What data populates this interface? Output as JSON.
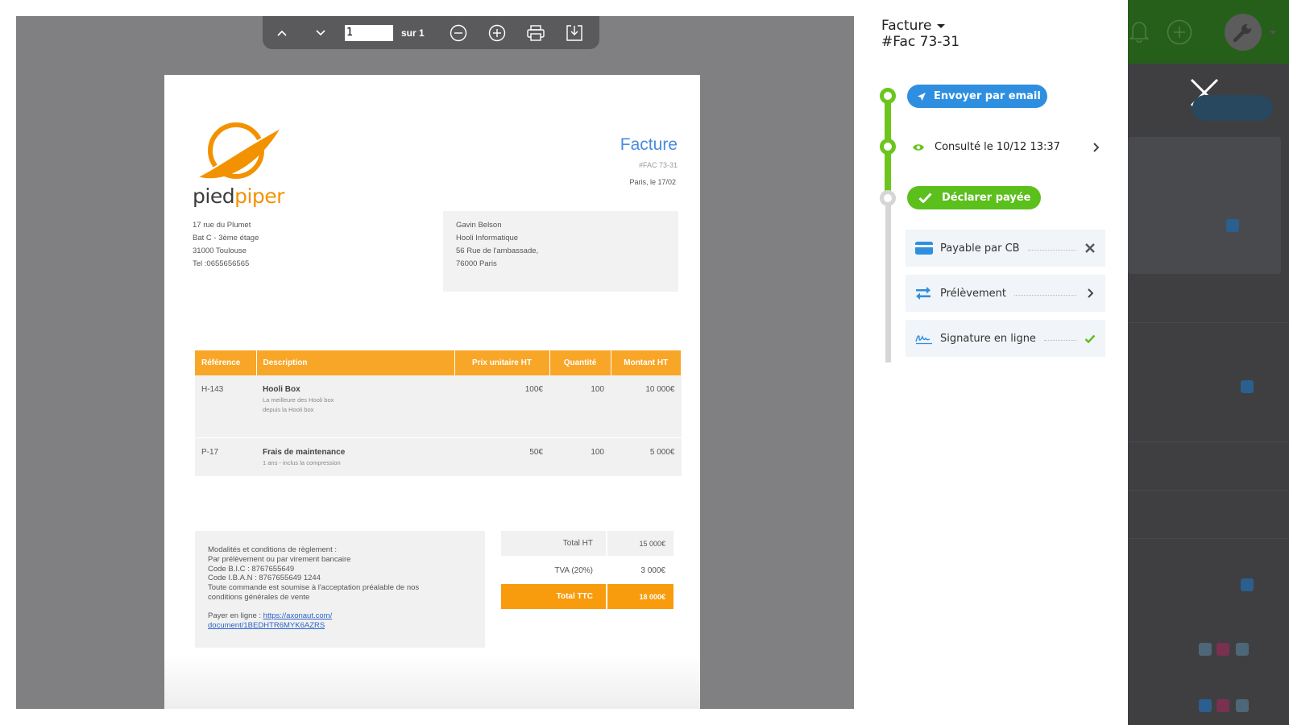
{
  "viewer": {
    "toolbar": {
      "page_value": "1",
      "page_of": "sur 1",
      "buttons": [
        "chevron-up-icon",
        "chevron-down-icon",
        "zoom-out-icon",
        "zoom-in-icon",
        "print-icon",
        "download-icon"
      ]
    }
  },
  "invoice": {
    "brand_part1": "pied",
    "brand_part2": "piper",
    "title": "Facture",
    "number": "#FAC 73-31",
    "date": "Paris, le 17/02",
    "sender": [
      "17 rue du Plumet",
      "Bat C - 3ème étage",
      "31000 Toulouse",
      "Tel :0655656565"
    ],
    "recipient": [
      "Gavin Belson",
      "Hooli Informatique",
      "56 Rue de l'ambassade,",
      "76000 Paris"
    ],
    "table": {
      "headers": [
        "Référence",
        "Description",
        "Prix unitaire HT",
        "Quantité",
        "Montant HT"
      ],
      "rows": [
        {
          "ref": "H-143",
          "name": "Hooli Box",
          "desc1": "La meilleure des Hooli box",
          "desc2": "depuis la Hooli box",
          "price": "100€",
          "qty": "100",
          "amount": "10 000€"
        },
        {
          "ref": "P-17",
          "name": "Frais de maintenance",
          "desc1": "1 ans - inclus la compression",
          "desc2": "",
          "price": "50€",
          "qty": "100",
          "amount": "5 000€"
        }
      ]
    },
    "conditions": {
      "lines": [
        "Modalités et conditions de règlement :",
        "Par prélèvement ou par virement bancaire",
        "Code B.I.C : 8767655649",
        "Code I.B.A.N : 8767655649 1244",
        "Toute commande est soumise à l'acceptation préalable de nos",
        "conditions générales de vente"
      ],
      "pay_label": "Payer en ligne : ",
      "link1": "https://axonaut.com/",
      "link2": "document/1BEDHTR6MYK6AZRS"
    },
    "totals": {
      "ht_label": "Total HT",
      "ht_value": "15 000€",
      "tva_label": "TVA (20%)",
      "tva_value": "3 000€",
      "ttc_label": "Total TTC",
      "ttc_value": "18 000€"
    }
  },
  "panel": {
    "title_line1": "Facture",
    "title_line2": "#Fac 73-31",
    "send_email": "Envoyer par email",
    "viewed": "Consulté le 10/12 13:37",
    "declare_paid": "Déclarer payée",
    "options": [
      {
        "label": "Payable par CB",
        "icon": "credit-card-icon",
        "end": "close-icon"
      },
      {
        "label": "Prélèvement",
        "icon": "transfer-icon",
        "end": "chevron-right-icon"
      },
      {
        "label": "Signature en ligne",
        "icon": "signature-icon",
        "end": "check-icon"
      }
    ]
  },
  "colors": {
    "accent_orange": "#f8a627",
    "accent_blue": "#2e8fe0",
    "accent_green": "#5bbf1c",
    "title_blue": "#4a8be0"
  }
}
